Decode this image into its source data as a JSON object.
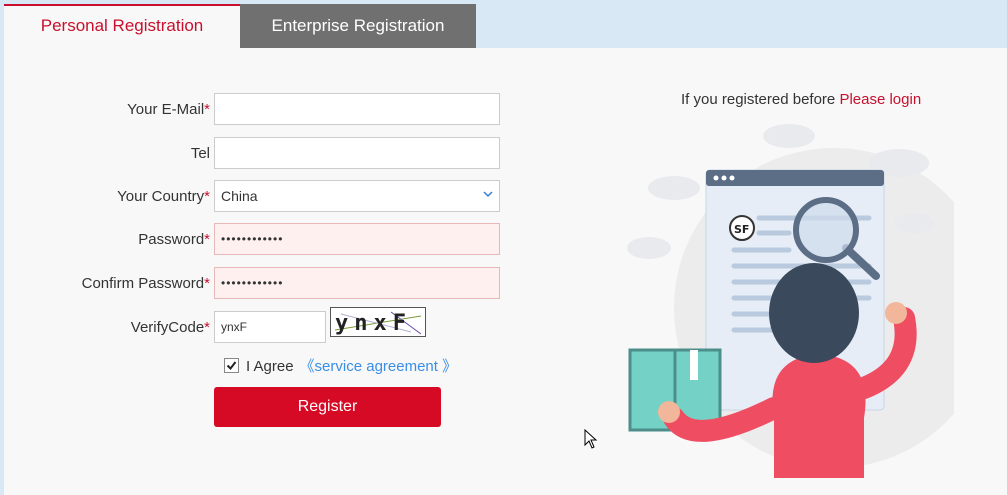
{
  "tabs": [
    {
      "label": "Personal Registration"
    },
    {
      "label": "Enterprise Registration"
    }
  ],
  "login": {
    "prefix": "If you registered before",
    "link": "Please login"
  },
  "form": {
    "email": {
      "label": "Your E-Mail",
      "required": "*",
      "value": ""
    },
    "tel": {
      "label": "Tel",
      "value": ""
    },
    "country": {
      "label": "Your Country",
      "required": "*",
      "value": "China"
    },
    "password": {
      "label": "Password",
      "required": "*",
      "value": "••••••••••••"
    },
    "confirm": {
      "label": "Confirm Password",
      "required": "*",
      "value": "••••••••••••"
    },
    "verify": {
      "label": "VerifyCode",
      "required": "*",
      "value": "ynxF",
      "captcha_text": "ynxF"
    },
    "agree": {
      "checked": true,
      "label": "I Agree",
      "link": "《service agreement 》"
    },
    "register_label": "Register"
  },
  "colors": {
    "accent": "#c8102e",
    "button": "#d70a25",
    "link": "#3a8ee6"
  },
  "illustration": {
    "logo_text": "SF"
  }
}
